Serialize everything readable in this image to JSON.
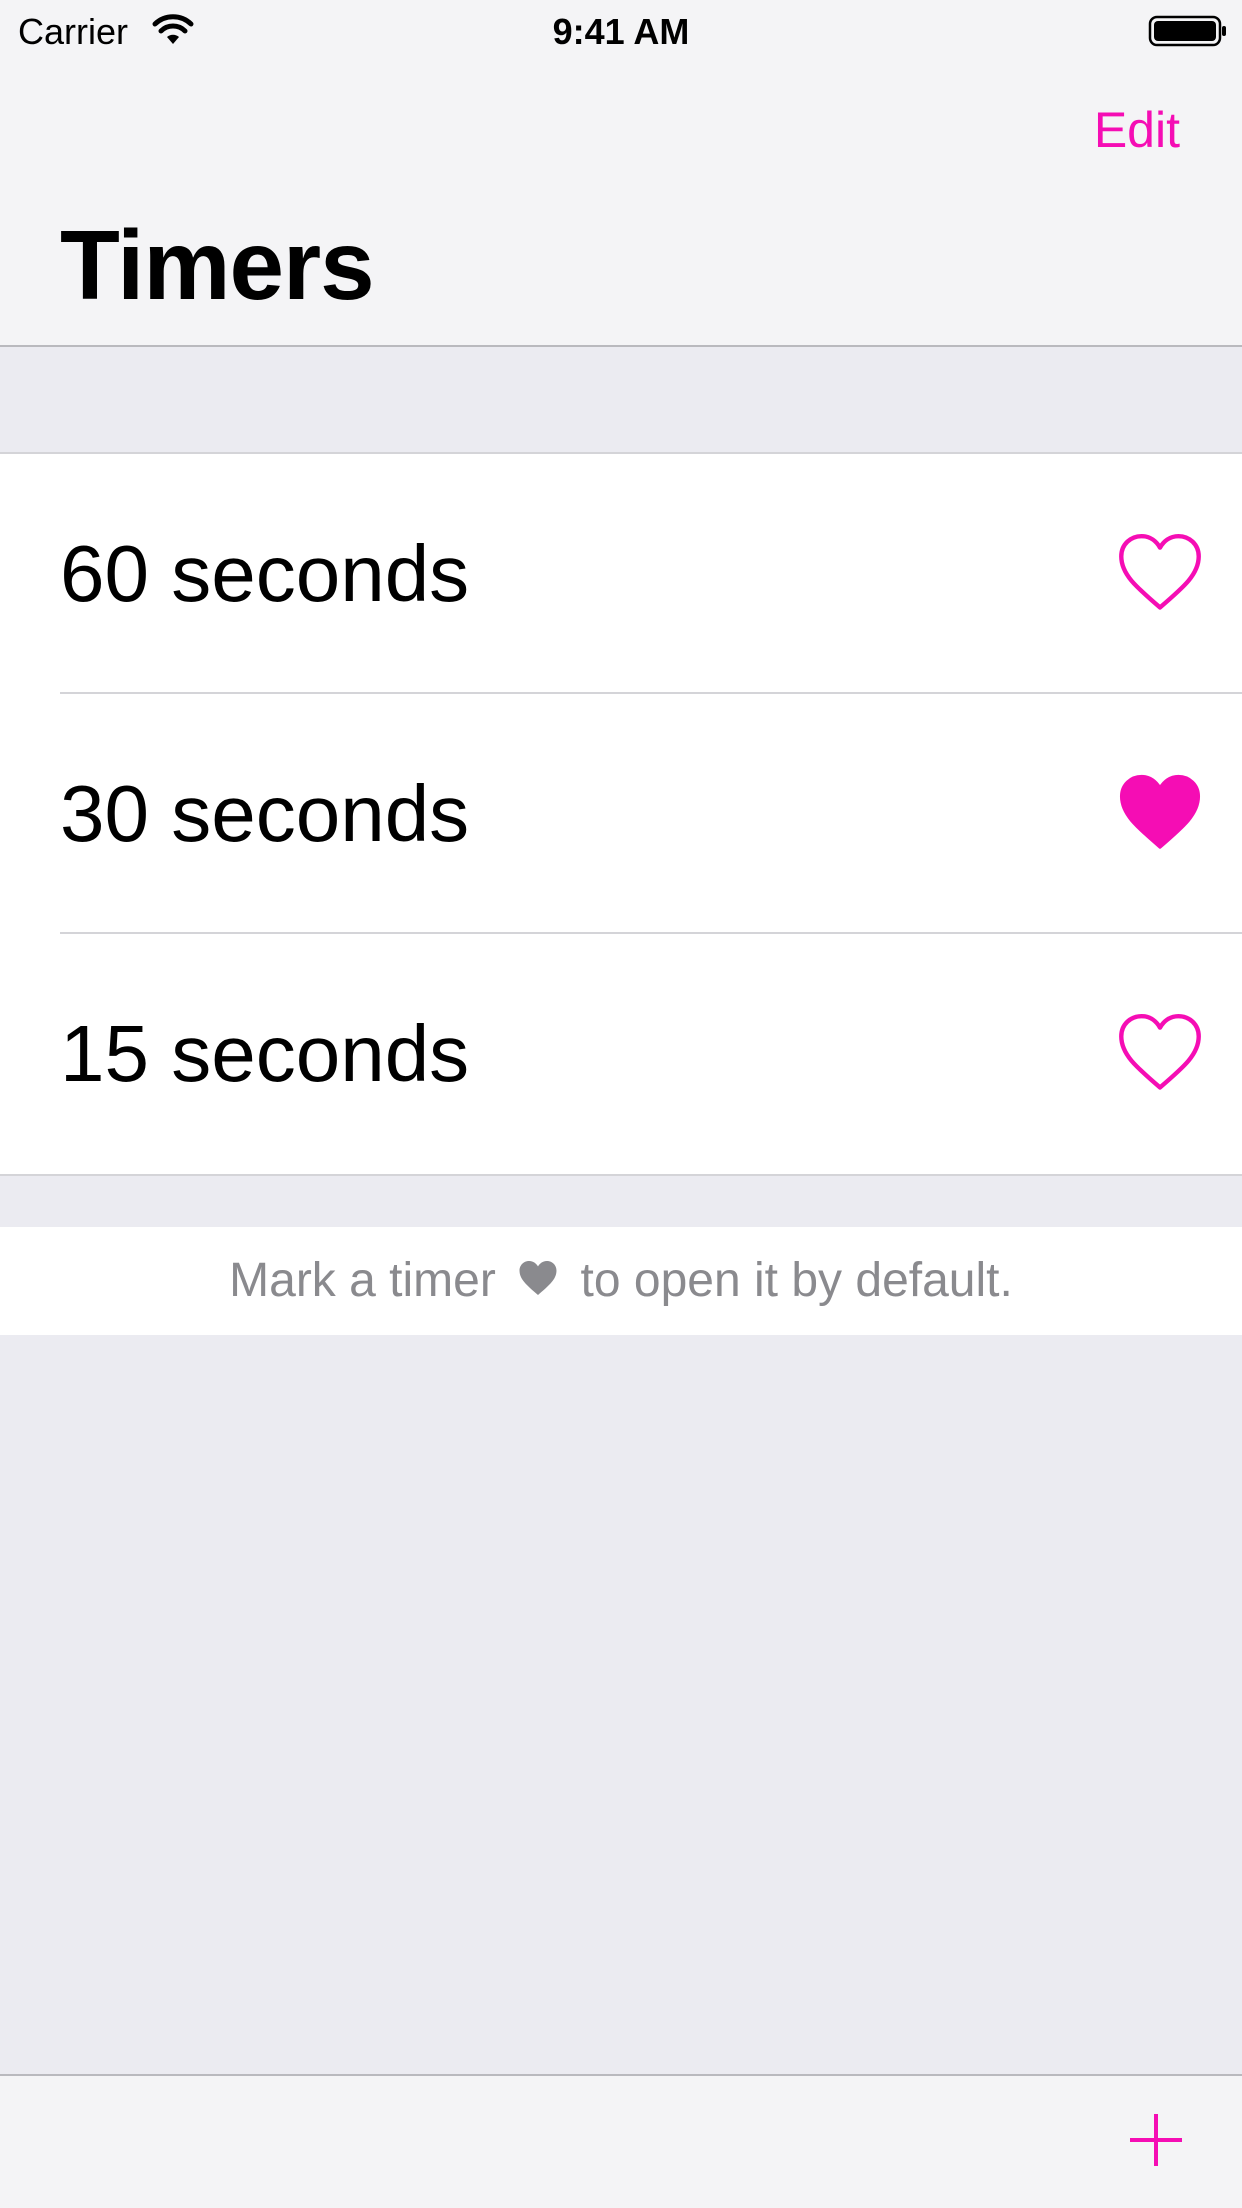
{
  "status_bar": {
    "carrier": "Carrier",
    "time": "9:41 AM",
    "wifi_icon": "wifi-icon",
    "battery_icon": "battery-full-icon"
  },
  "nav": {
    "edit_label": "Edit",
    "title": "Timers"
  },
  "timers": [
    {
      "label": "60 seconds",
      "favorite": false,
      "icon": "heart-outline-icon"
    },
    {
      "label": "30 seconds",
      "favorite": true,
      "icon": "heart-filled-icon"
    },
    {
      "label": "15 seconds",
      "favorite": false,
      "icon": "heart-outline-icon"
    }
  ],
  "footer": {
    "note_before": "Mark a timer",
    "note_after": "to open it by default.",
    "heart_icon": "heart-filled-icon"
  },
  "toolbar": {
    "add_icon": "plus-icon"
  },
  "colors": {
    "accent": "#F50DB4",
    "background": "#EBEBF1",
    "bar_background": "#F4F4F6",
    "footer_text": "#8A8A8E"
  }
}
